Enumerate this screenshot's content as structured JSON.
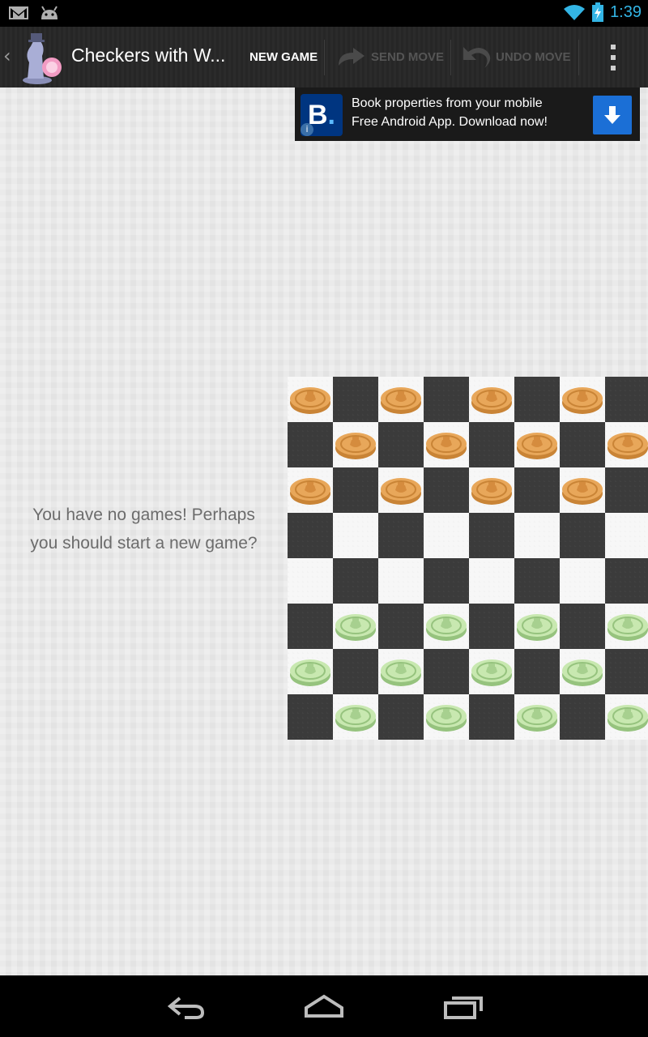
{
  "status_bar": {
    "left_icons": [
      "gmail-icon",
      "android-icon"
    ],
    "right_icons": [
      "wifi-icon",
      "battery-charging-icon"
    ],
    "time": "1:39",
    "accent_color": "#33b5e5"
  },
  "action_bar": {
    "title": "Checkers with W...",
    "actions": [
      {
        "label": "NEW GAME",
        "enabled": true
      },
      {
        "label": "SEND MOVE",
        "enabled": false
      },
      {
        "label": "UNDO MOVE",
        "enabled": false
      }
    ],
    "overflow_icon": "more-vert-icon"
  },
  "ad": {
    "brand_letter": "B",
    "line1": "Book properties from your mobile",
    "line2": "Free Android App. Download now!",
    "brand_color": "#003580",
    "download_color": "#1b6fd6"
  },
  "main": {
    "empty_line1": "You have no games! Perhaps",
    "empty_line2": "you should start a new game?"
  },
  "board": {
    "rows": 8,
    "cols": 8,
    "orange_rows": [
      0,
      1,
      2
    ],
    "green_rows": [
      5,
      6,
      7
    ],
    "orange_color": "#e8a75a",
    "green_color": "#c8e8b0"
  },
  "nav_bar": {
    "buttons": [
      "back-icon",
      "home-icon",
      "recent-apps-icon"
    ]
  }
}
